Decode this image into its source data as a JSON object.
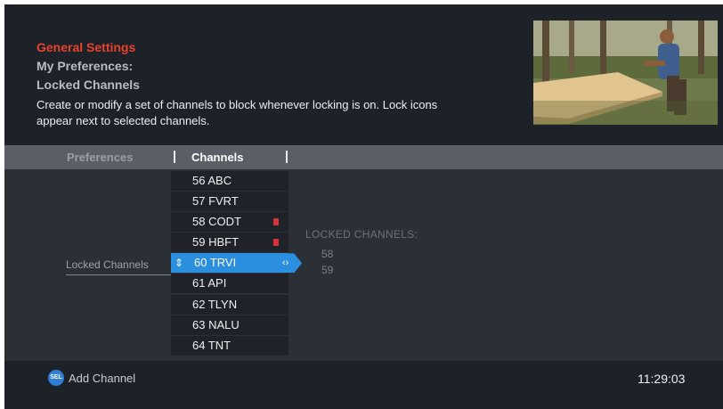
{
  "header": {
    "breadcrumb_1": "General Settings",
    "breadcrumb_2": "My Preferences:",
    "breadcrumb_3": "Locked Channels",
    "description": "Create or modify a set of channels to block whenever locking is on. Lock icons appear next to selected channels."
  },
  "tabs": [
    {
      "label": "Preferences"
    },
    {
      "label": "Channels"
    }
  ],
  "field_label": "Locked Channels",
  "channels": [
    {
      "label": "56 ABC",
      "locked": false
    },
    {
      "label": "57 FVRT",
      "locked": false
    },
    {
      "label": "58 CODT",
      "locked": true
    },
    {
      "label": "59 HBFT",
      "locked": true
    },
    {
      "label": "60 TRVI",
      "locked": false,
      "selected": true
    },
    {
      "label": "61 API",
      "locked": false
    },
    {
      "label": "62 TLYN",
      "locked": false
    },
    {
      "label": "63 NALU",
      "locked": false
    },
    {
      "label": "64 TNT",
      "locked": false
    }
  ],
  "locked_summary": {
    "title": "LOCKED CHANNELS:",
    "items": [
      "58",
      "59"
    ]
  },
  "footer": {
    "button_glyph": "SEL",
    "button_label": "Add Channel",
    "clock": "11:29:03"
  },
  "colors": {
    "accent": "#2b8fe0",
    "breadcrumb_red": "#e8422d",
    "lock_red": "#d9323b",
    "background": "#1d2128"
  },
  "icons": {
    "lock": "lock-icon",
    "updown": "updown-arrows-icon",
    "leftright": "leftright-arrows-icon",
    "select_button": "sel-button-icon"
  }
}
